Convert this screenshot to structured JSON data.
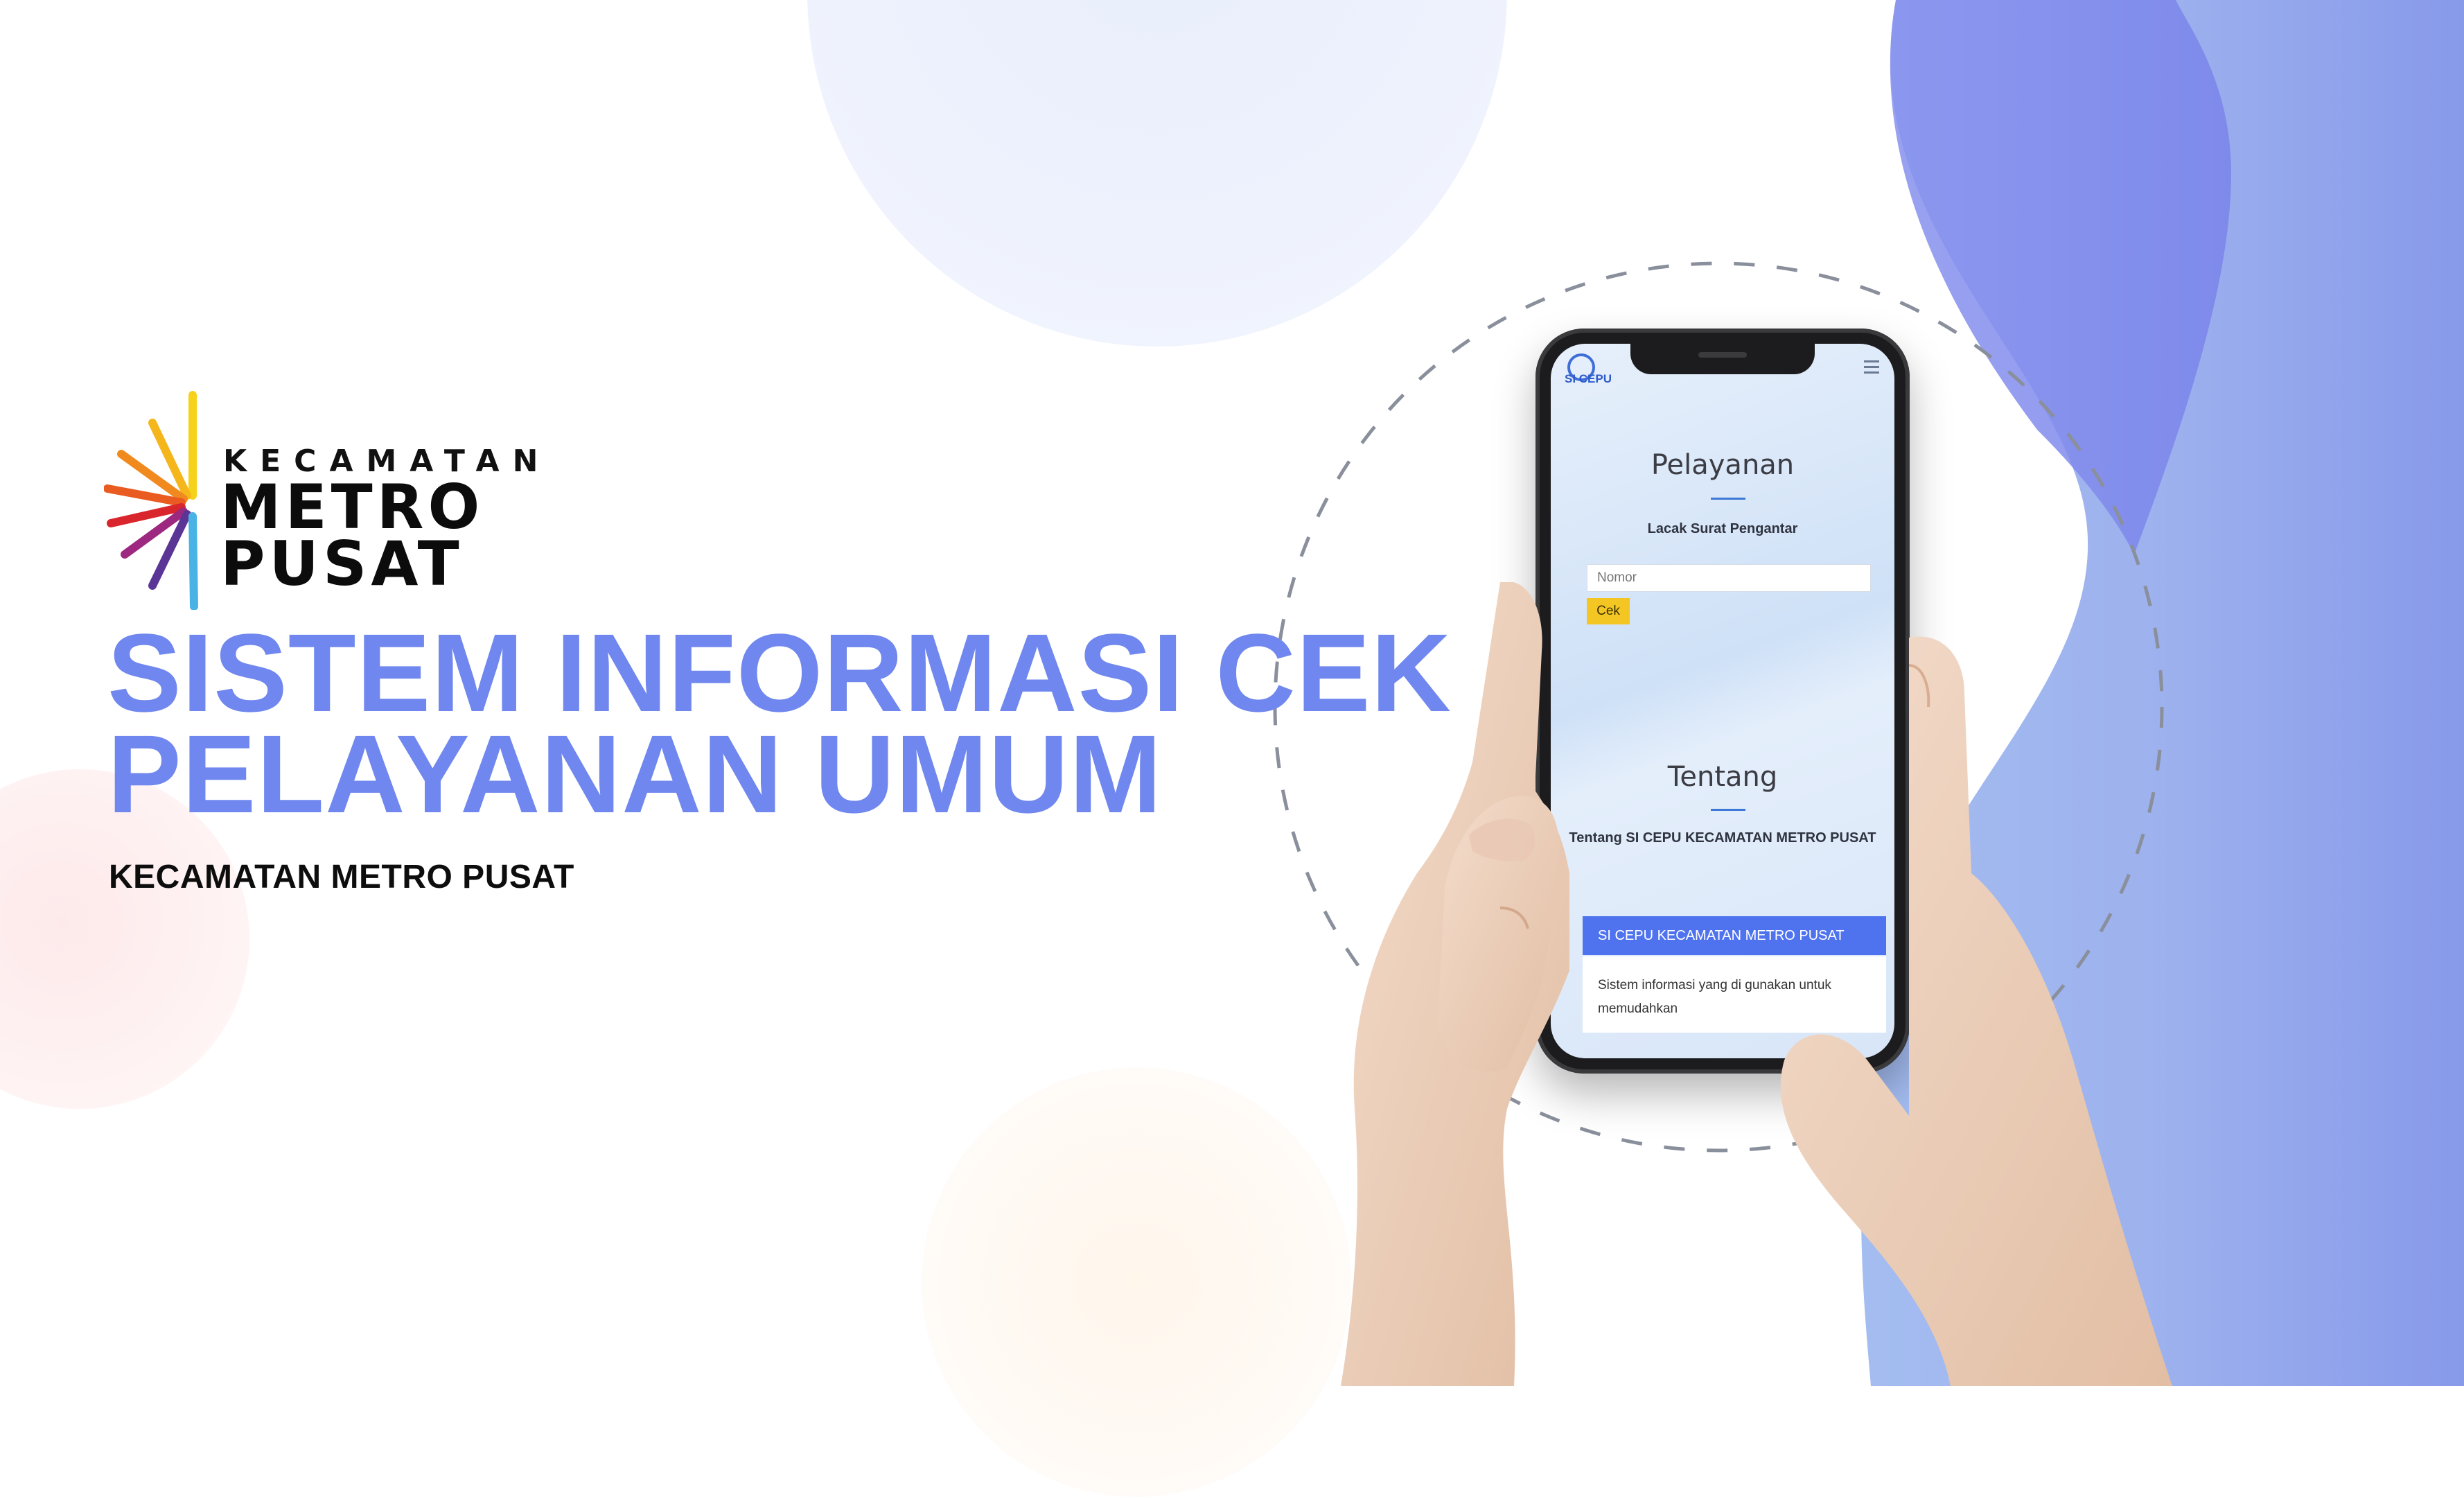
{
  "brand": {
    "line_small": "KECAMATAN",
    "line_big_1": "METRO",
    "line_big_2": "PUSAT"
  },
  "headline": {
    "line_1": "SISTEM INFORMASI CEK",
    "line_2": "PELAYANAN UMUM"
  },
  "subtitle": "KECAMATAN METRO PUSAT",
  "phone_screen": {
    "app_logo": "SI CEPU",
    "section_1_title": "Pelayanan",
    "section_1_label": "Lacak Surat Pengantar",
    "input_placeholder": "Nomor",
    "check_button": "Cek",
    "section_2_title": "Tentang",
    "section_2_label": "Tentang SI CEPU KECAMATAN METRO PUSAT",
    "bar_text": "SI CEPU KECAMATAN METRO PUSAT",
    "body_text": "Sistem informasi yang di gunakan untuk memudahkan"
  },
  "colors": {
    "headline": "#6f87ee",
    "wave": "#7b89ec",
    "wave_light": "#9fb7ee",
    "button": "#f3c623",
    "bar": "#4f73ee"
  }
}
